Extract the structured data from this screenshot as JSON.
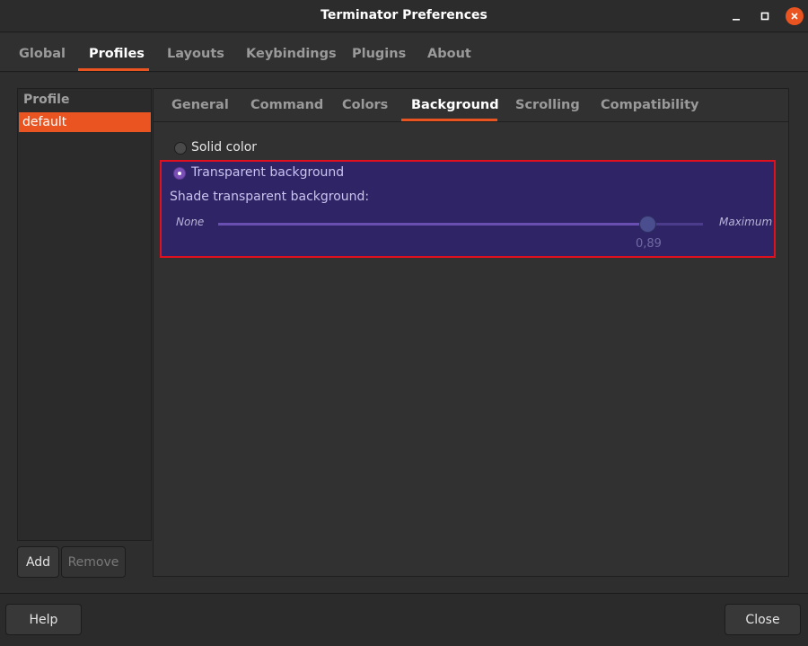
{
  "window": {
    "title": "Terminator Preferences",
    "controls": {
      "minimize_icon": "minimize-icon",
      "maximize_icon": "maximize-icon",
      "close_icon": "close-icon",
      "close_color": "#e95420"
    }
  },
  "outer_tabs": [
    "Global",
    "Profiles",
    "Layouts",
    "Keybindings",
    "Plugins",
    "About"
  ],
  "outer_tabs_active": "Profiles",
  "accent": "#e95420",
  "profiles": {
    "header": "Profile",
    "items": [
      "default"
    ],
    "selected": "default",
    "add_label": "Add",
    "remove_label": "Remove"
  },
  "inner_tabs": [
    "General",
    "Command",
    "Colors",
    "Background",
    "Scrolling",
    "Compatibility"
  ],
  "inner_tabs_active": "Background",
  "background": {
    "solid_color_label": "Solid color",
    "transparent_label": "Transparent background",
    "selected": "Transparent background",
    "shade_label": "Shade transparent background:",
    "slider_min_label": "None",
    "slider_max_label": "Maximum",
    "slider_value": "0,89",
    "slider_fraction": 0.89,
    "highlight_bg": "#2e2466",
    "highlight_border": "#e0101e"
  },
  "footer": {
    "help_label": "Help",
    "close_label": "Close"
  }
}
